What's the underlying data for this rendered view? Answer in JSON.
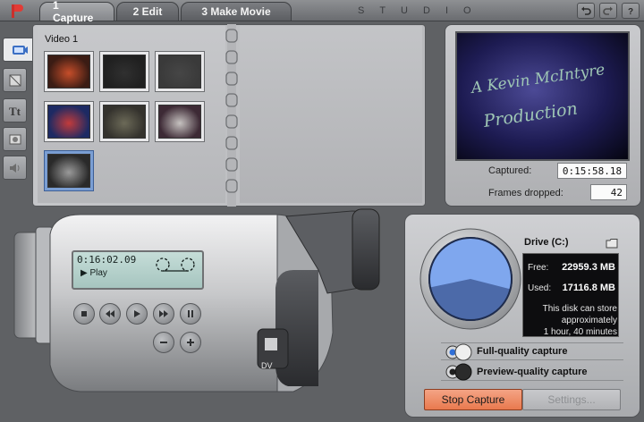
{
  "tabs": [
    {
      "label": "1 Capture"
    },
    {
      "label": "2 Edit"
    },
    {
      "label": "3 Make Movie"
    }
  ],
  "brand": "STUDIO",
  "album": {
    "title": "Video 1",
    "clips": [
      {
        "tone": "#3b1c14",
        "accent": "#c64e2a",
        "selected": false
      },
      {
        "tone": "#202020",
        "accent": "#303030",
        "selected": false
      },
      {
        "tone": "#3a3a3a",
        "accent": "#464646",
        "selected": false
      },
      {
        "tone": "#1d2a63",
        "accent": "#c23b3b",
        "selected": false
      },
      {
        "tone": "#34322d",
        "accent": "#6c6a58",
        "selected": false
      },
      {
        "tone": "#3d2a35",
        "accent": "#c6c2c0",
        "selected": false
      },
      {
        "tone": "#2a2a2a",
        "accent": "#9a9a9a",
        "selected": true
      }
    ]
  },
  "preview": {
    "line1": "A Kevin McIntyre",
    "line2": "Production",
    "captured_label": "Captured:",
    "captured_value": "0:15:58.18",
    "dropped_label": "Frames dropped:",
    "dropped_value": "42"
  },
  "camcorder": {
    "timecode": "0:16:02.09",
    "status": "▶ Play",
    "dv_label": "DV"
  },
  "drive": {
    "label": "Drive (C:)",
    "free_label": "Free:",
    "free_value": "22959.3 MB",
    "used_label": "Used:",
    "used_value": "17116.8 MB",
    "free_fraction": 0.573,
    "note_line1": "This disk can store",
    "note_line2": "approximately",
    "note_line3": "1 hour, 40 minutes"
  },
  "capture_options": {
    "full_label": "Full-quality capture",
    "preview_label": "Preview-quality capture",
    "selected": "full"
  },
  "buttons": {
    "stop_label": "Stop Capture",
    "settings_label": "Settings..."
  },
  "colors": {
    "accent_stop": "#ec8a62",
    "selection_blue": "#7a9ed3"
  }
}
